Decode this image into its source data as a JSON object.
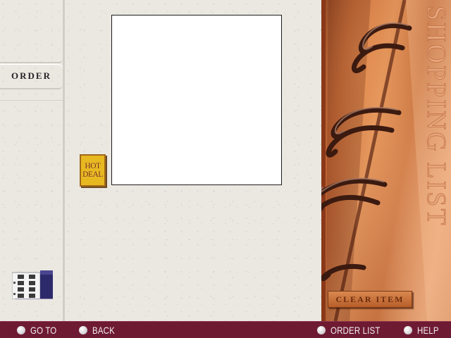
{
  "sidebar": {
    "tabs": [
      {
        "label": "ORDER"
      }
    ]
  },
  "main": {
    "hot_deal_badge": {
      "line1": "HOT",
      "line2": "DEAL"
    }
  },
  "right_panel": {
    "title": "SHOPPING LIST",
    "clear_item_label": "CLEAR ITEM"
  },
  "bottom_bar": {
    "goto_label": "GO TO",
    "back_label": "BACK",
    "order_list_label": "ORDER LIST",
    "help_label": "HELP"
  },
  "colors": {
    "bottom_bar": "#6e1a32",
    "paper": "#ebe8e2",
    "accent_orange": "#c06a38",
    "hot_deal_yellow": "#e8b820"
  },
  "icons": [
    "keypad-icon",
    "circle-bullet-icon"
  ]
}
